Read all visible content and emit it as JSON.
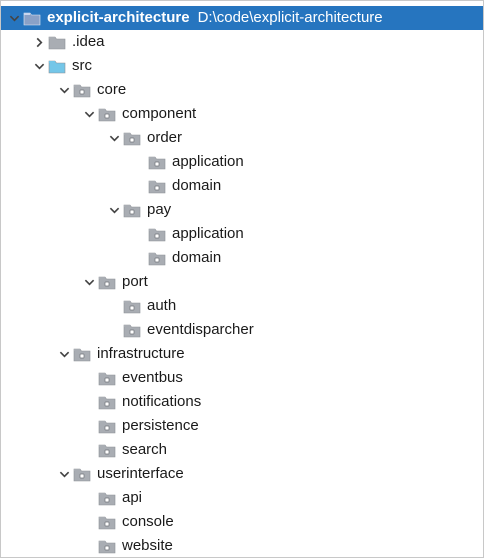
{
  "tree": [
    {
      "name": "explicit-architecture",
      "path": "D:\\code\\explicit-architecture",
      "depth": 0,
      "expanded": true,
      "selected": true,
      "icon": "module-folder-icon"
    },
    {
      "name": ".idea",
      "depth": 1,
      "expanded": false,
      "icon": "folder-icon"
    },
    {
      "name": "src",
      "depth": 1,
      "expanded": true,
      "icon": "source-folder-icon"
    },
    {
      "name": "core",
      "depth": 2,
      "expanded": true,
      "icon": "package-icon"
    },
    {
      "name": "component",
      "depth": 3,
      "expanded": true,
      "icon": "package-icon"
    },
    {
      "name": "order",
      "depth": 4,
      "expanded": true,
      "icon": "package-icon"
    },
    {
      "name": "application",
      "depth": 5,
      "icon": "package-icon"
    },
    {
      "name": "domain",
      "depth": 5,
      "icon": "package-icon"
    },
    {
      "name": "pay",
      "depth": 4,
      "expanded": true,
      "icon": "package-icon"
    },
    {
      "name": "application",
      "depth": 5,
      "icon": "package-icon"
    },
    {
      "name": "domain",
      "depth": 5,
      "icon": "package-icon"
    },
    {
      "name": "port",
      "depth": 3,
      "expanded": true,
      "icon": "package-icon"
    },
    {
      "name": "auth",
      "depth": 4,
      "icon": "package-icon"
    },
    {
      "name": "eventdisparcher",
      "depth": 4,
      "icon": "package-icon"
    },
    {
      "name": "infrastructure",
      "depth": 2,
      "expanded": true,
      "icon": "package-icon"
    },
    {
      "name": "eventbus",
      "depth": 3,
      "icon": "package-icon"
    },
    {
      "name": "notifications",
      "depth": 3,
      "icon": "package-icon"
    },
    {
      "name": "persistence",
      "depth": 3,
      "icon": "package-icon"
    },
    {
      "name": "search",
      "depth": 3,
      "icon": "package-icon"
    },
    {
      "name": "userinterface",
      "depth": 2,
      "expanded": true,
      "icon": "package-icon"
    },
    {
      "name": "api",
      "depth": 3,
      "icon": "package-icon"
    },
    {
      "name": "console",
      "depth": 3,
      "icon": "package-icon"
    },
    {
      "name": "website",
      "depth": 3,
      "icon": "package-icon"
    }
  ],
  "colors": {
    "selection": "#2675bf",
    "folder": "#a9adb3",
    "source_folder": "#74c6e8",
    "module_folder": "#8aa1c7"
  }
}
